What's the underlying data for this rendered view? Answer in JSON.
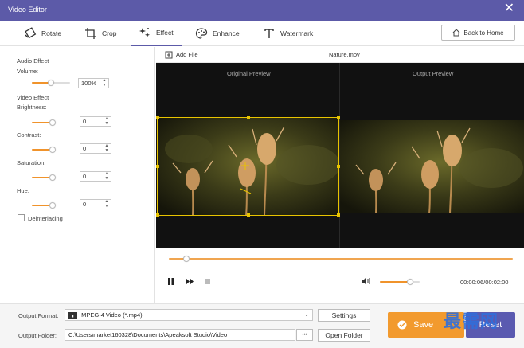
{
  "window": {
    "title": "Video Editor",
    "close_glyph": "✕"
  },
  "tabs": [
    {
      "label": "Rotate",
      "icon": "rotate-icon"
    },
    {
      "label": "Crop",
      "icon": "crop-icon"
    },
    {
      "label": "Effect",
      "icon": "effect-icon",
      "active": true
    },
    {
      "label": "Enhance",
      "icon": "enhance-icon"
    },
    {
      "label": "Watermark",
      "icon": "watermark-icon"
    }
  ],
  "back_home_label": "Back to Home",
  "left": {
    "audio_effect": "Audio Effect",
    "volume_label": "Volume:",
    "volume_value": "100%",
    "video_effect": "Video Effect",
    "brightness_label": "Brightness:",
    "brightness_value": "0",
    "contrast_label": "Contrast:",
    "contrast_value": "0",
    "saturation_label": "Saturation:",
    "saturation_value": "0",
    "hue_label": "Hue:",
    "hue_value": "0",
    "deinterlacing_label": "Deinterlacing"
  },
  "preview": {
    "add_file": "Add File",
    "file_name": "Nature.mov",
    "original_label": "Original Preview",
    "output_label": "Output Preview"
  },
  "player": {
    "time": "00:00:06/00:02:00",
    "progress_fraction": 0.05,
    "volume_fraction": 0.75
  },
  "bottom": {
    "format_label": "Output Format:",
    "format_value": "MPEG-4 Video (*.mp4)",
    "settings_label": "Settings",
    "folder_label": "Output Folder:",
    "folder_value": "C:\\Users\\market160328\\Documents\\Apeaksoft Studio\\Video",
    "folder_more": "•••",
    "open_folder_label": "Open Folder",
    "save_label": "Save",
    "reset_label": "Reset"
  },
  "watermark_text": "最需网",
  "colors": {
    "accent": "#5c5aa8",
    "orange": "#f29a2e",
    "crop": "#e8c400"
  }
}
